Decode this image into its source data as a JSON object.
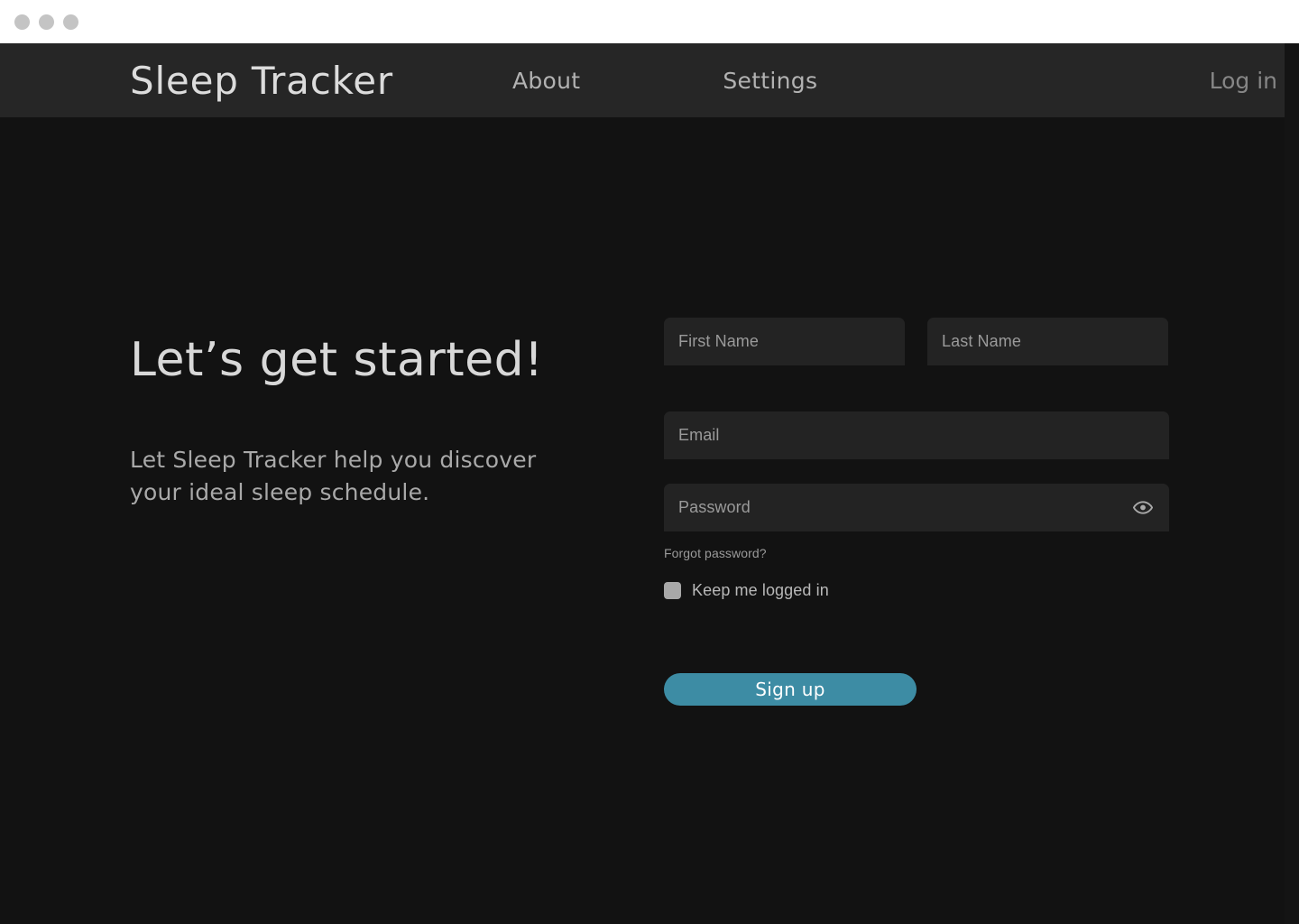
{
  "window": {
    "traffic_lights": [
      "close",
      "minimize",
      "maximize"
    ]
  },
  "nav": {
    "brand": "Sleep Tracker",
    "links": [
      {
        "label": "About"
      },
      {
        "label": "Settings"
      }
    ],
    "login_label": "Log in"
  },
  "hero": {
    "title": "Let’s get started!",
    "subtitle": "Let Sleep Tracker help you discover your ideal sleep schedule."
  },
  "form": {
    "first_name": {
      "placeholder": "First Name",
      "value": ""
    },
    "last_name": {
      "placeholder": "Last Name",
      "value": ""
    },
    "email": {
      "placeholder": "Email",
      "value": ""
    },
    "password": {
      "placeholder": "Password",
      "value": ""
    },
    "show_password_icon": "eye-icon",
    "forgot_password_label": "Forgot password?",
    "keep_logged_in_label": "Keep me logged in",
    "keep_logged_in_checked": false,
    "submit_label": "Sign up"
  },
  "colors": {
    "page_background": "#121212",
    "navbar_background": "#262626",
    "titlebar_background": "#ffffff",
    "field_background": "#232323",
    "accent": "#3d8ca4",
    "heading_text": "#d8d8d8",
    "muted_text": "#9a9a9a"
  }
}
